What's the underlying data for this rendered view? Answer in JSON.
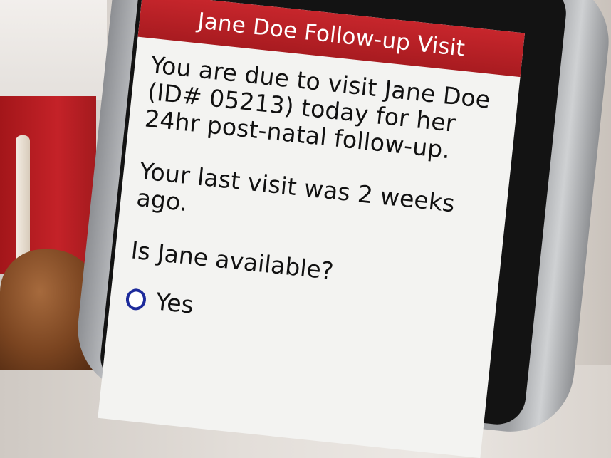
{
  "screen": {
    "title": "Jane Doe Follow-up Visit",
    "message_1": "You are due to visit Jane Doe (ID# 05213) today for her 24hr post-natal follow-up.",
    "message_2": "Your last visit was 2 weeks ago.",
    "question": "Is Jane available?",
    "options": [
      {
        "label": "Yes",
        "selected": false
      }
    ]
  },
  "colors": {
    "title_bar": "#b82026",
    "radio": "#1c2a9b"
  }
}
